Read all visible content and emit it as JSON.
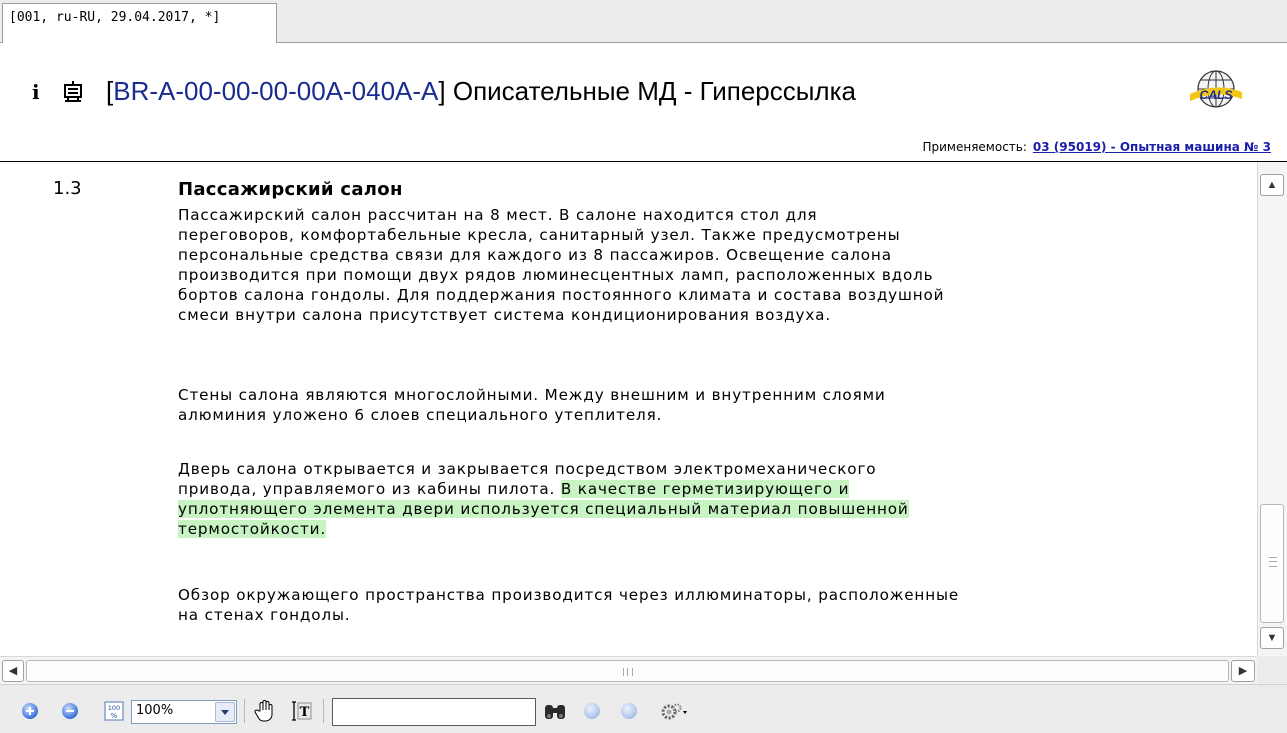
{
  "tab": {
    "label": "[001, ru-RU, 29.04.2017, *]"
  },
  "header": {
    "title_open": "[",
    "title_code": "BR-A-00-00-00-00A-040A-A",
    "title_close": "]",
    "title_text": " Описательные МД - Гиперссылка",
    "icons": {
      "info": "info-icon",
      "doc": "document-icon",
      "logo": "cals-logo"
    },
    "applicability_label": "Применяемость:",
    "applicability_link": "03 (95019) - Опытная машина № 3"
  },
  "content": {
    "section_number": "1.3",
    "section_title": "Пассажирский салон",
    "paragraphs": [
      {
        "lines": [
          "Пассажирский салон рассчитан на 8 мест. В салоне находится стол для",
          "переговоров, комфортабельные кресла, санитарный узел. Также предусмотрены",
          "персональные средства связи для каждого из 8 пассажиров. Освещение салона",
          "производится при помощи двух рядов люминесцентных ламп, расположенных вдоль",
          "бортов салона гондолы. Для поддержания постоянного климата и состава воздушной",
          "смеси внутри салона присутствует система кондиционирования воздуха."
        ]
      },
      {
        "lines": [
          "Стены салона являются многослойными. Между внешним и внутренним слоями",
          "алюминия уложено 6 слоев специального утеплителя."
        ]
      },
      {
        "line1": "Дверь салона открывается и закрывается посредством электромеханического",
        "line2_plain": "привода, управляемого из кабины пилота. ",
        "line2_hl": "В качестве герметизирующего и ",
        "line3_hl": "уплотняющего элемента двери используется специальный материал повышенной ",
        "line4_hl": "термостойкости.",
        "highlight_color": "#c8f4c4"
      },
      {
        "lines": [
          "Обзор окружающего пространства производится через иллюминаторы, расположенные",
          "на стенах гондолы."
        ]
      }
    ]
  },
  "toolbar": {
    "zoom_value": "100%",
    "search_value": "",
    "icons": [
      "zoom-in-icon",
      "zoom-out-icon",
      "fit-page-icon",
      "hand-tool-icon",
      "text-select-icon",
      "binoculars-icon",
      "prev-result-icon",
      "next-result-icon",
      "settings-icon"
    ]
  }
}
